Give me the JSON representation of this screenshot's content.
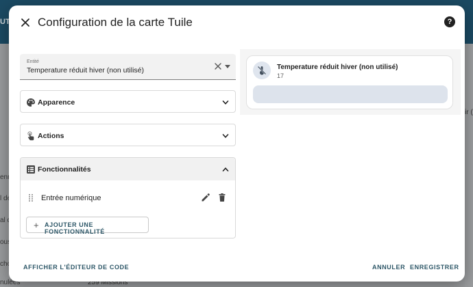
{
  "background": {
    "topbar_tab": "UTE",
    "left_row_fragments": [
      "enn",
      "l de",
      "al d",
      "ous",
      "cho"
    ],
    "right_fragment": "ir (",
    "bottom_left": "nulées",
    "bottom_right": "259 Missions"
  },
  "dialog": {
    "title": "Configuration de la carte Tuile",
    "help_symbol": "?"
  },
  "entity": {
    "label": "Entité",
    "value": "Temperature réduit hiver (non utilisé)"
  },
  "panels": {
    "appearance": {
      "label": "Apparence",
      "icon": "palette-icon"
    },
    "actions": {
      "label": "Actions",
      "icon": "gesture-tap-icon"
    },
    "features": {
      "label": "Fonctionnalités",
      "icon": "list-box-icon",
      "items": [
        {
          "label": "Entrée numérique"
        }
      ],
      "add_label": "AJOUTER UNE FONCTIONNALITÉ"
    }
  },
  "preview": {
    "name": "Temperature réduit hiver (non utilisé)",
    "state": "17",
    "icon": "thermometer-off-icon"
  },
  "footer": {
    "code_editor": "AFFICHER L'ÉDITEUR DE CODE",
    "cancel": "ANNULER",
    "save": "ENREGISTRER"
  },
  "colors": {
    "accent_text": "#2b5566",
    "tile_icon_bg": "#dfe5ee",
    "tile_feature_bg": "#dde3ec"
  }
}
